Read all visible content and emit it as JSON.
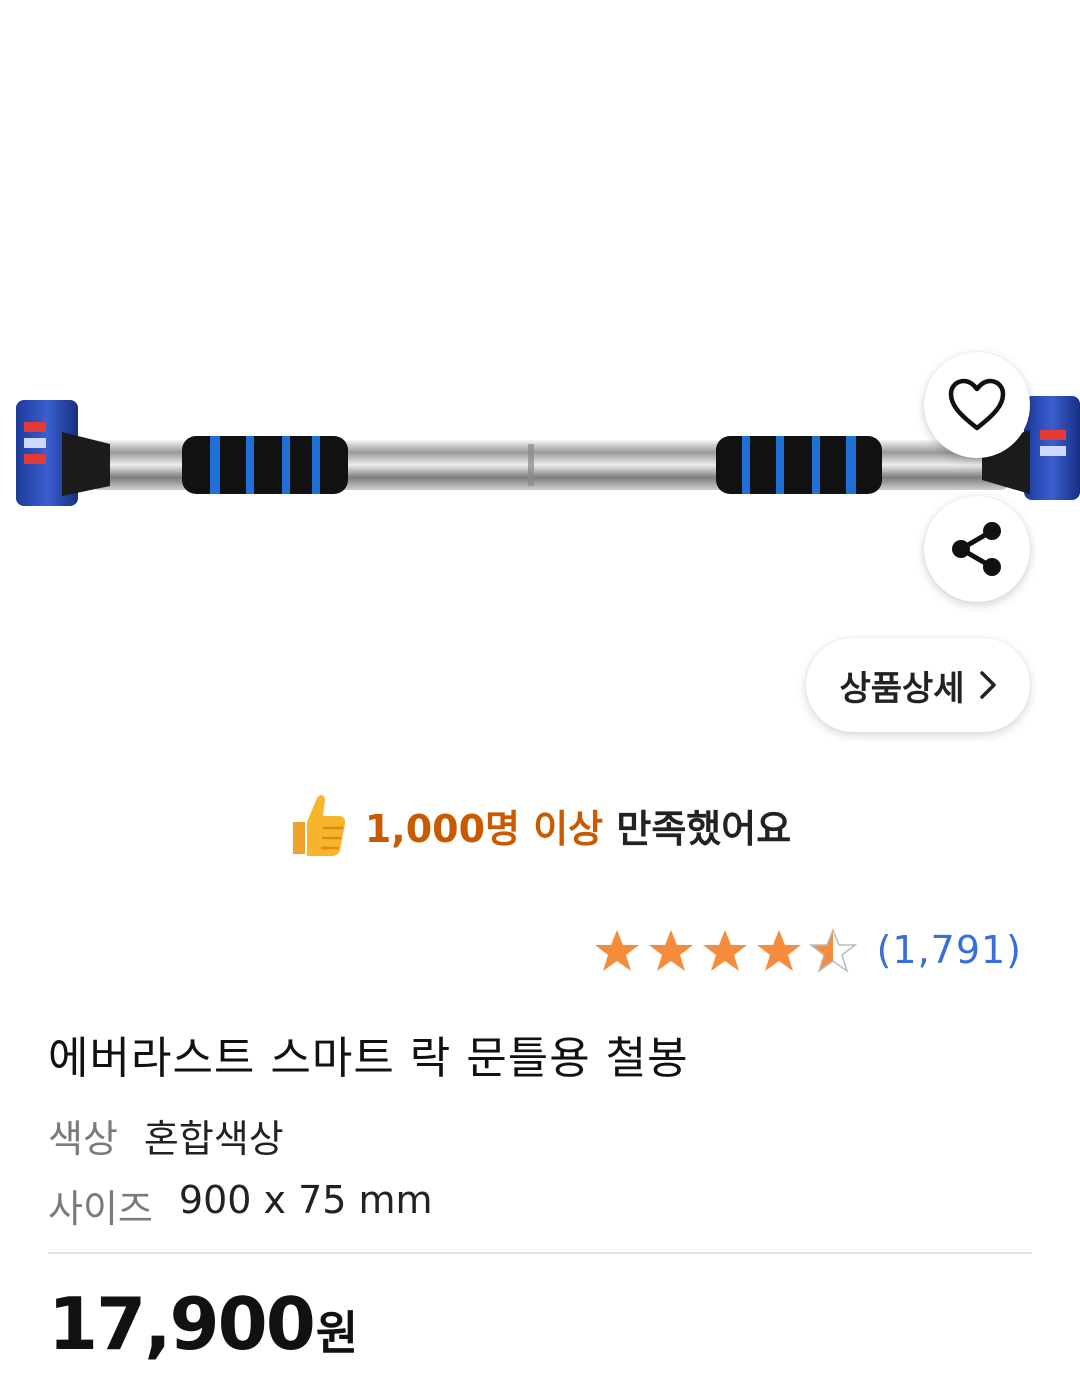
{
  "product": {
    "image_alt": "철봉",
    "title": "에버라스트 스마트 락 문틀용 철봉",
    "options": [
      {
        "key": "색상",
        "value": "혼합색상"
      },
      {
        "key": "사이즈",
        "value": "900 x 75 mm"
      }
    ],
    "price": "17,900",
    "price_unit": "원"
  },
  "actions": {
    "like_icon": "heart-icon",
    "share_icon": "share-icon",
    "detail_label": "상품상세",
    "detail_icon": "chevron-right-icon"
  },
  "satisfaction": {
    "icon": "thumbs-up-icon",
    "highlight": "1,000명 이상",
    "rest": "만족했어요"
  },
  "rating": {
    "stars": 4.5,
    "max": 5,
    "count_text": "(1,791)"
  },
  "colors": {
    "accent_orange": "#c95a00",
    "star": "#f58c3c",
    "link_blue": "#3a6fd8"
  }
}
